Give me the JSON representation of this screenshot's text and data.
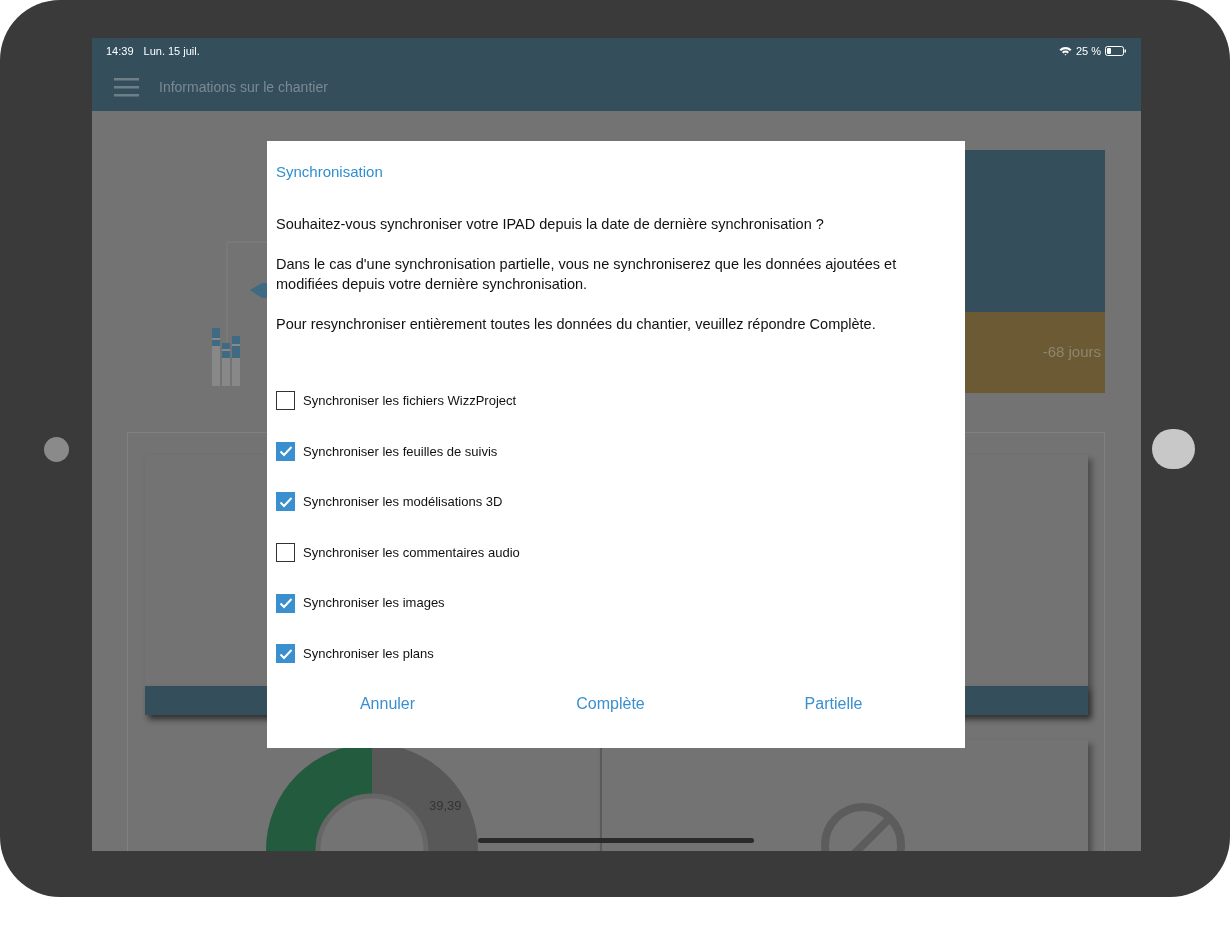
{
  "status_bar": {
    "time": "14:39",
    "date": "Lun. 15 juil.",
    "battery": "25 %"
  },
  "header": {
    "title": "Informations sur le chantier"
  },
  "background": {
    "delay_badge": "-68 jours",
    "donut_label": "39,39"
  },
  "dialog": {
    "title": "Synchronisation",
    "paragraphs": [
      "Souhaitez-vous synchroniser votre IPAD depuis la date de dernière synchronisation ?",
      "Dans le cas d'une synchronisation partielle, vous ne synchroniserez que les données ajoutées et modifiées depuis votre dernière synchronisation.",
      "Pour resynchroniser entièrement toutes les données du chantier, veuillez répondre Complète."
    ],
    "options": [
      {
        "label": "Synchroniser les fichiers WizzProject",
        "checked": false
      },
      {
        "label": "Synchroniser les feuilles de suivis",
        "checked": true
      },
      {
        "label": "Synchroniser les modélisations 3D",
        "checked": true
      },
      {
        "label": "Synchroniser les commentaires audio",
        "checked": false
      },
      {
        "label": "Synchroniser les images",
        "checked": true
      },
      {
        "label": "Synchroniser les plans",
        "checked": true
      }
    ],
    "buttons": [
      "Annuler",
      "Complète",
      "Partielle"
    ]
  }
}
